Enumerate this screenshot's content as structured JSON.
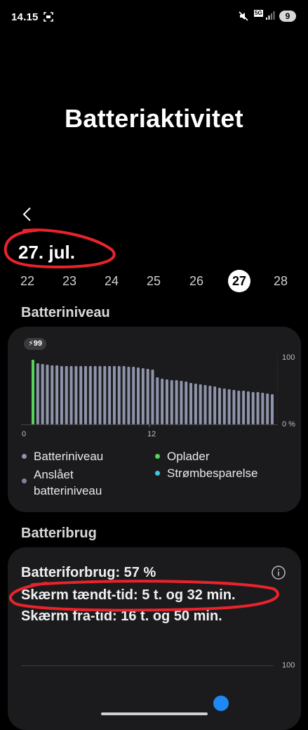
{
  "status_bar": {
    "time": "14.15",
    "network": "5G",
    "notification_count": "9"
  },
  "page": {
    "title": "Batteriaktivitet",
    "back_icon": "chevron-left-icon"
  },
  "date": {
    "label": "27. jul."
  },
  "days": {
    "items": [
      "22",
      "23",
      "24",
      "25",
      "26",
      "27",
      "28"
    ],
    "selected": "27"
  },
  "battery_level": {
    "section_title": "Batteriniveau",
    "charge_badge": "99",
    "y_axis": {
      "max_label": "100",
      "min_label": "0 %"
    },
    "x_axis": {
      "start_label": "0",
      "mid_label": "12"
    },
    "legend": {
      "level": "Batteriniveau",
      "estimated": "Anslået batteriniveau",
      "charger": "Oplader",
      "power_saving": "Strømbesparelse"
    },
    "colors": {
      "bar": "#8e94aa",
      "charger": "#55d35b",
      "power_saving": "#3ec8df",
      "estimated": "#7f8597"
    }
  },
  "chart_data": {
    "type": "bar",
    "x_range": [
      0,
      24
    ],
    "ylim": [
      0,
      100
    ],
    "x_ticks": [
      "0",
      "12"
    ],
    "y_ticks": [
      "0 %",
      "100"
    ],
    "charging_bar_index": 0,
    "values": [
      92,
      87,
      86,
      85,
      84,
      84,
      83,
      83,
      83,
      83,
      83,
      83,
      83,
      83,
      83,
      83,
      83,
      83,
      83,
      83,
      82,
      82,
      81,
      80,
      79,
      78,
      67,
      65,
      64,
      63,
      63,
      62,
      61,
      59,
      58,
      57,
      56,
      55,
      54,
      52,
      51,
      50,
      49,
      48,
      48,
      47,
      46,
      46,
      45,
      44,
      43
    ]
  },
  "battery_usage": {
    "section_title": "Batteribrug",
    "consumption": "Batteriforbrug: 57 %",
    "screen_on": "Skærm tændt-tid: 5 t. og 32 min.",
    "screen_off": "Skærm fra-tid: 16 t. og 50 min.",
    "axis_max_label": "100",
    "info_icon": "info-icon"
  }
}
